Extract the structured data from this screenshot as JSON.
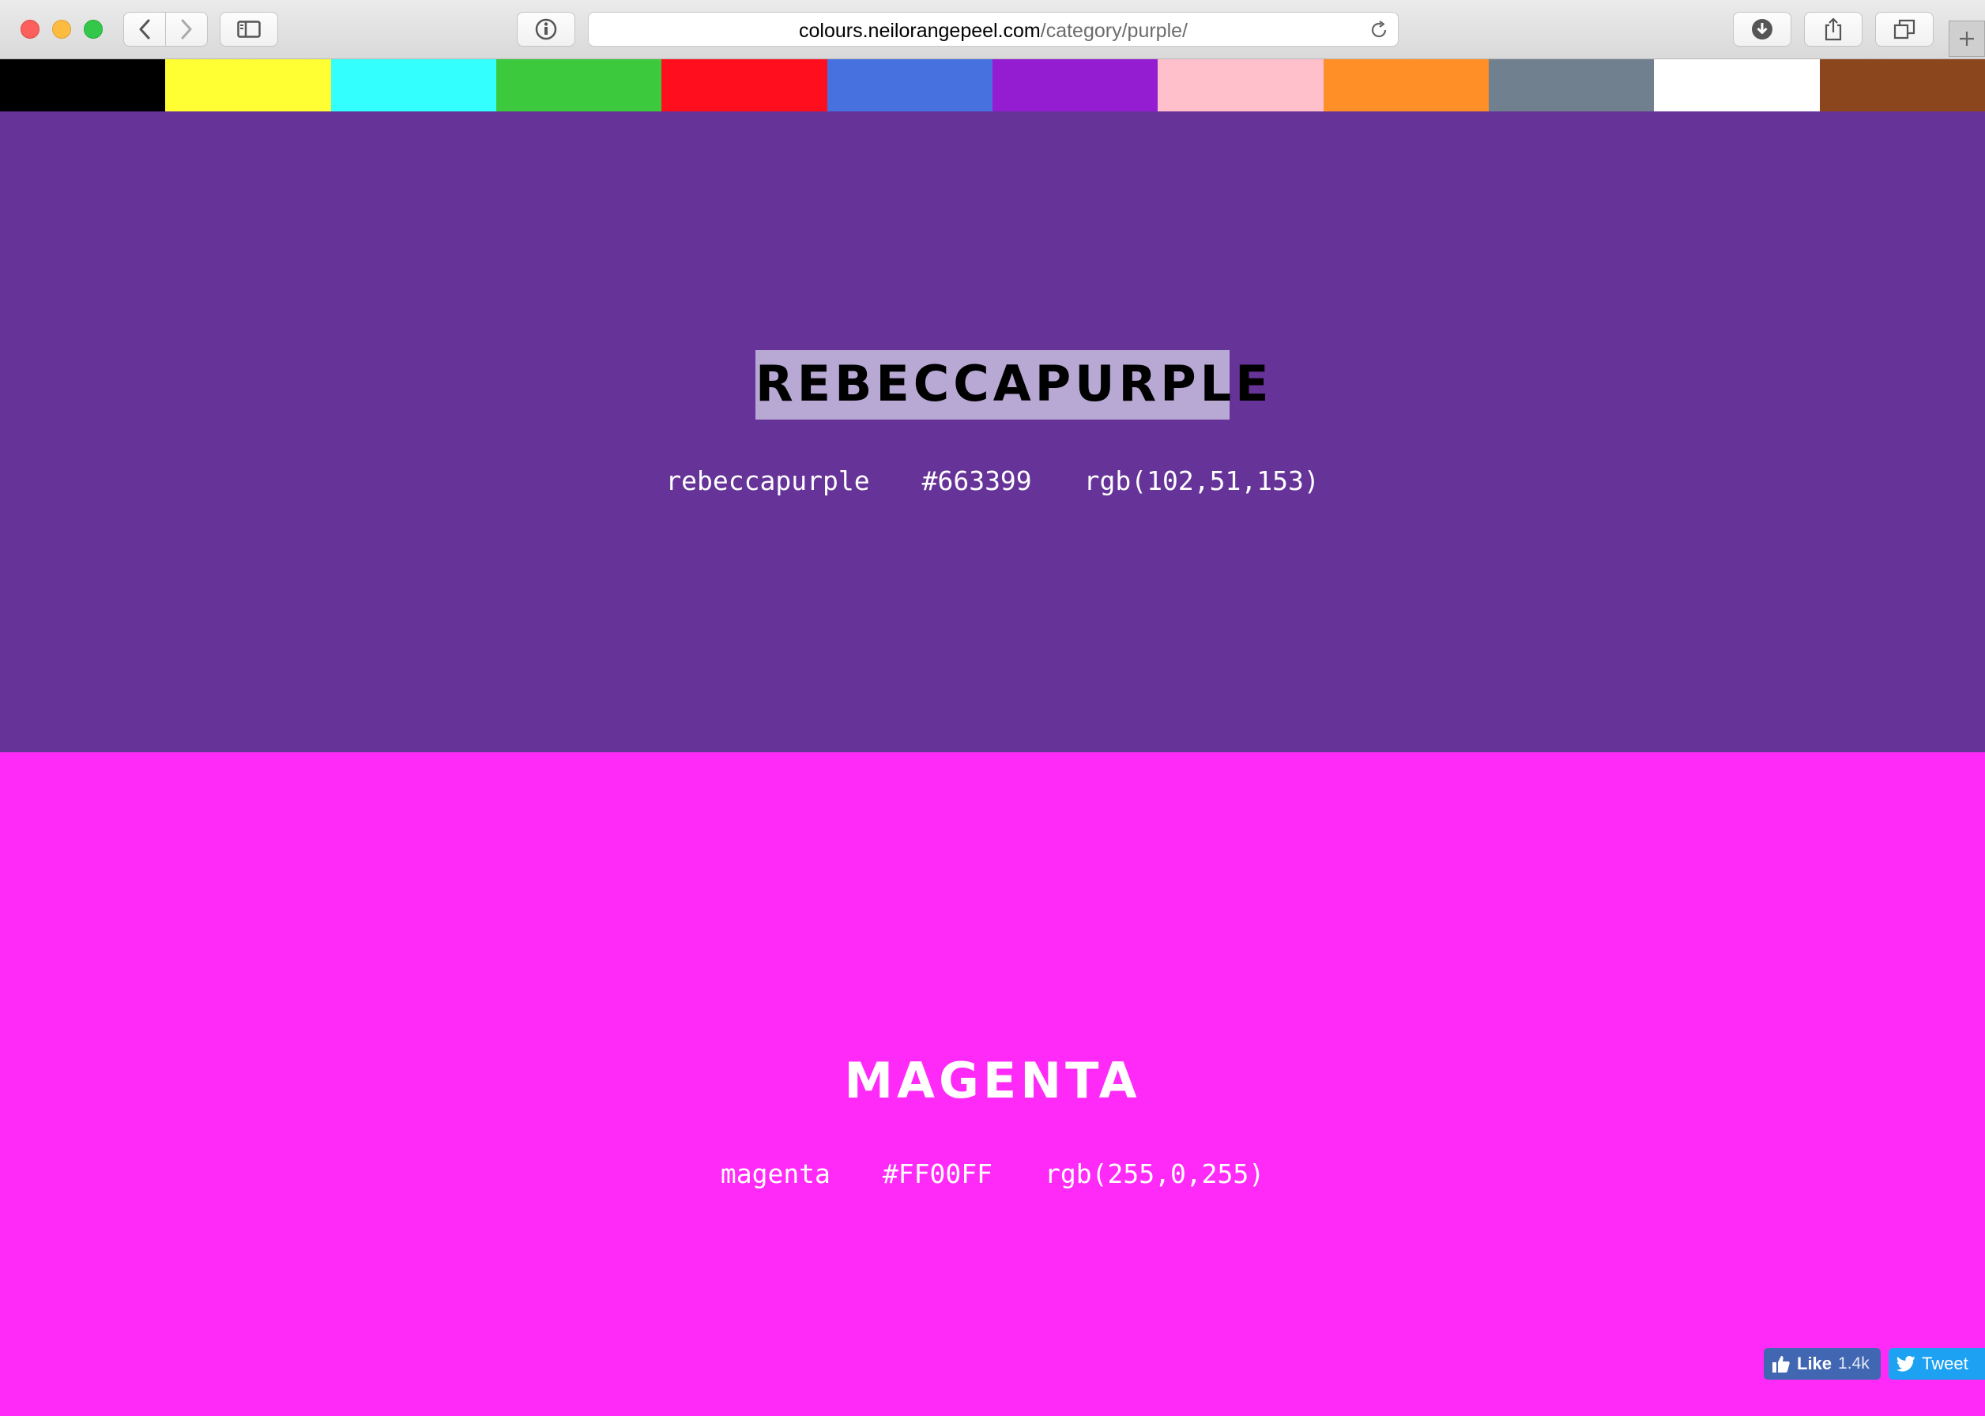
{
  "browser": {
    "url_host": "colours.neilorangepeel.com",
    "url_path": "/category/purple/"
  },
  "colour_nav": [
    {
      "name": "black",
      "hex": "#000000"
    },
    {
      "name": "yellow",
      "hex": "#FFFF33"
    },
    {
      "name": "cyan",
      "hex": "#33FFFF"
    },
    {
      "name": "green",
      "hex": "#3DC93D"
    },
    {
      "name": "red",
      "hex": "#FF0F1E"
    },
    {
      "name": "blue",
      "hex": "#4771DF"
    },
    {
      "name": "purple",
      "hex": "#951DD1"
    },
    {
      "name": "pink",
      "hex": "#FFC0CB"
    },
    {
      "name": "orange",
      "hex": "#FF8F26"
    },
    {
      "name": "gray",
      "hex": "#71808F"
    },
    {
      "name": "white",
      "hex": "#FFFFFF"
    },
    {
      "name": "brown",
      "hex": "#8C461D"
    }
  ],
  "colours": [
    {
      "title": "REBECCAPURPLE",
      "keyword": "rebeccapurple",
      "hex": "#663399",
      "rgb": "rgb(102,51,153)",
      "background": "#663399"
    },
    {
      "title": "MAGENTA",
      "keyword": "magenta",
      "hex": "#FF00FF",
      "rgb": "rgb(255,0,255)",
      "background": "#FF2AF7"
    }
  ],
  "social": {
    "like_label": "Like",
    "like_count": "1.4k",
    "tweet_label": "Tweet"
  }
}
